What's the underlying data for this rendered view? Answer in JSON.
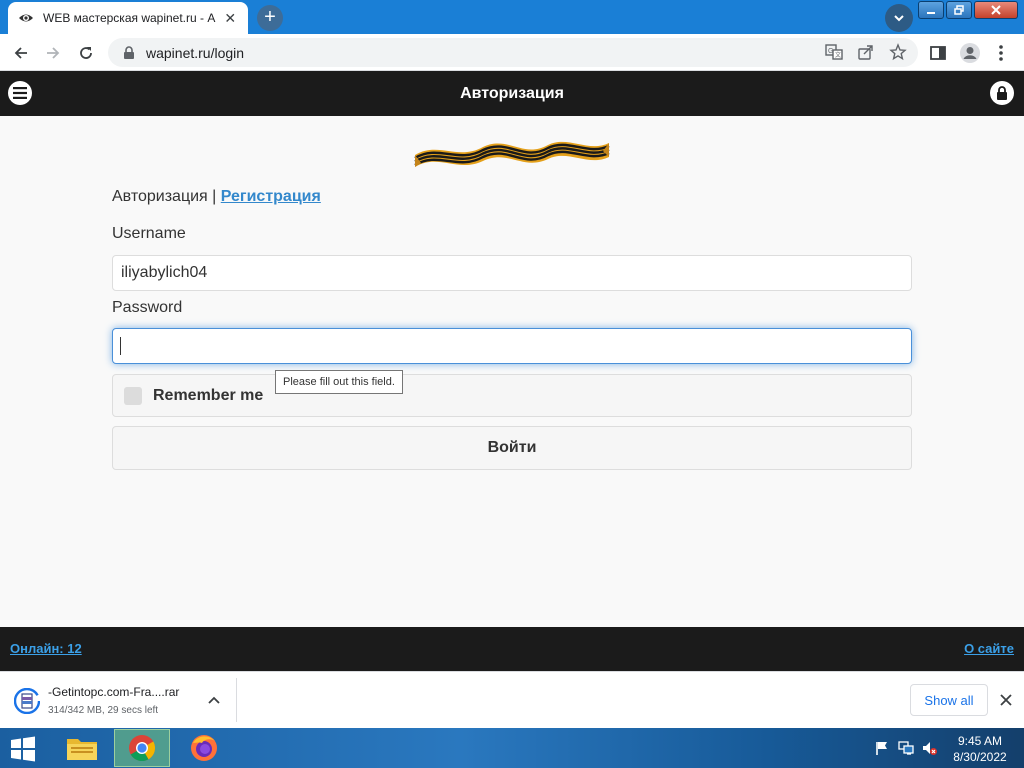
{
  "browser": {
    "tab_title": "WEB мастерская wapinet.ru - Ав",
    "url": "wapinet.ru/login"
  },
  "page": {
    "header_title": "Авторизация",
    "auth_link_current": "Авторизация",
    "auth_separator": " | ",
    "auth_link_register": "Регистрация",
    "username_label": "Username",
    "username_value": "iliyabylich04",
    "password_label": "Password",
    "password_value": "",
    "remember_label": "Remember me",
    "validation_tooltip": "Please fill out this field.",
    "submit_label": "Войти",
    "footer_online": "Онлайн: 12",
    "footer_about": "О сайте"
  },
  "downloads": {
    "file_name": "-Getintopc.com-Fra....rar",
    "file_status": "314/342 MB, 29 secs left",
    "show_all_label": "Show all"
  },
  "taskbar": {
    "time": "9:45 AM",
    "date": "8/30/2022"
  }
}
